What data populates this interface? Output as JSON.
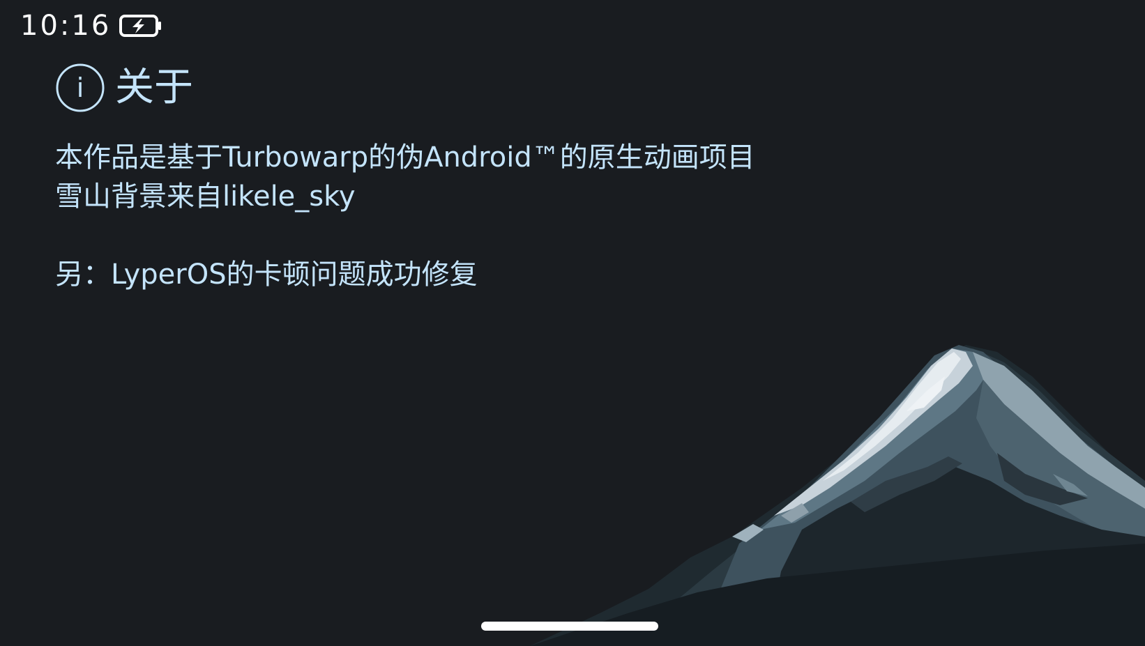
{
  "status_bar": {
    "time": "10:16",
    "battery_icon": "battery-charging-icon"
  },
  "header": {
    "icon": "info-icon",
    "info_glyph": "i",
    "title": "关于"
  },
  "content": {
    "line1": "本作品是基于Turbowarp的伪Android™的原生动画项目",
    "line2": "雪山背景来自likele_sky",
    "line3": "另：LyperOS的卡顿问题成功修复"
  },
  "background": {
    "image": "snow-mountain-illustration"
  },
  "navigation": {
    "home_indicator": "home-indicator"
  },
  "colors": {
    "background": "#191c20",
    "text_accent": "#c4e4fb",
    "status_text": "#ffffff"
  }
}
